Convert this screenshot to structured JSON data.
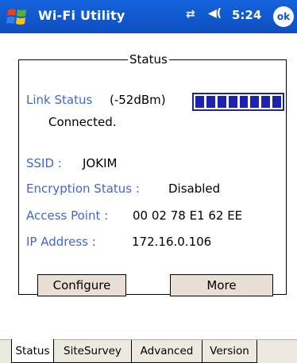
{
  "titlebar": {
    "app_title": "Wi-Fi Utility",
    "time": "5:24",
    "ok_label": "ok",
    "icons": [
      "windows-logo-icon",
      "connectivity-icon",
      "volume-icon"
    ]
  },
  "status": {
    "group_title": "Status",
    "link_status_label": "Link Status",
    "signal_dbm": "(-52dBm)",
    "signal_bars_filled": 8,
    "signal_bars_total": 8,
    "connection_state": "Connected.",
    "ssid_label": "SSID :",
    "ssid_value": "JOKIM",
    "encryption_label": "Encryption Status :",
    "encryption_value": "Disabled",
    "access_point_label": "Access Point :",
    "access_point_value": "00 02 78 E1 62 EE",
    "ip_label": "IP Address :",
    "ip_value": "172.16.0.106"
  },
  "buttons": {
    "configure": "Configure",
    "more": "More"
  },
  "tabs": [
    {
      "label": "Status",
      "active": true
    },
    {
      "label": "SiteSurvey",
      "active": false
    },
    {
      "label": "Advanced",
      "active": false
    },
    {
      "label": "Version",
      "active": false
    }
  ],
  "colors": {
    "titlebar": "#0d4fbf",
    "label_blue": "#4466cc",
    "signal_bar": "#1d22b0",
    "button_face": "#e8ded4"
  }
}
